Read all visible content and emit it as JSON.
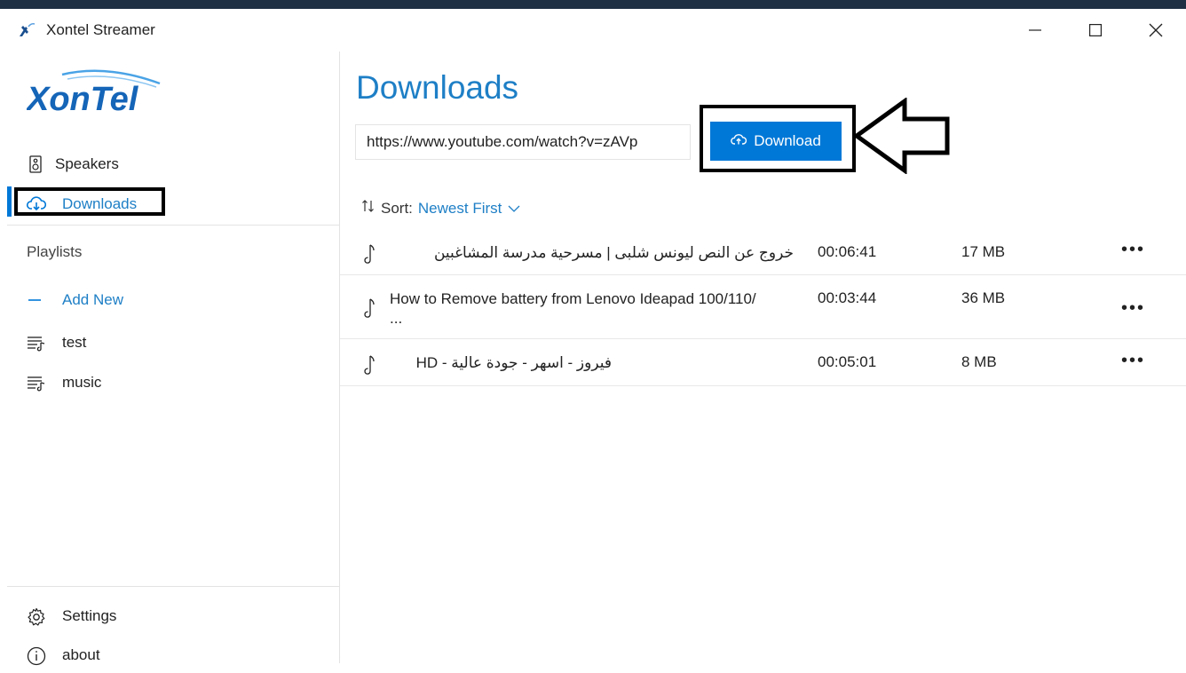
{
  "window": {
    "title": "Xontel Streamer",
    "controls": [
      "minimize",
      "maximize",
      "close"
    ]
  },
  "sidebar": {
    "logo_text": "XonTel",
    "nav": [
      {
        "label": "Speakers",
        "icon": "speaker-icon",
        "selected": false
      },
      {
        "label": "Downloads",
        "icon": "cloud-download-icon",
        "selected": true
      }
    ],
    "playlists_label": "Playlists",
    "add_new_label": "Add New",
    "playlists": [
      {
        "label": "test",
        "icon": "playlist-icon"
      },
      {
        "label": "music",
        "icon": "playlist-icon"
      }
    ],
    "footer": [
      {
        "label": "Settings",
        "icon": "gear-icon"
      },
      {
        "label": "about",
        "icon": "info-icon"
      }
    ]
  },
  "main": {
    "title": "Downloads",
    "url_value": "https://www.youtube.com/watch?v=zAVp",
    "download_label": "Download",
    "sort_label": "Sort:",
    "sort_value": "Newest First",
    "items": [
      {
        "name": "خروج عن النص ليونس شلبى | مسرحية مدرسة المشاغبين",
        "duration": "00:06:41",
        "size": "17 MB",
        "more": "•••"
      },
      {
        "name": "How to Remove battery from Lenovo Ideapad 100/110/ ...",
        "duration": "00:03:44",
        "size": "36 MB",
        "more": "•••"
      },
      {
        "name": "فيروز - اسهر - جودة عالية - HD",
        "duration": "00:05:01",
        "size": "8 MB",
        "more": "•••"
      }
    ]
  },
  "colors": {
    "accent": "#0078d7",
    "title_blue": "#1e7fc6",
    "logo_blue": "#1565b8"
  }
}
